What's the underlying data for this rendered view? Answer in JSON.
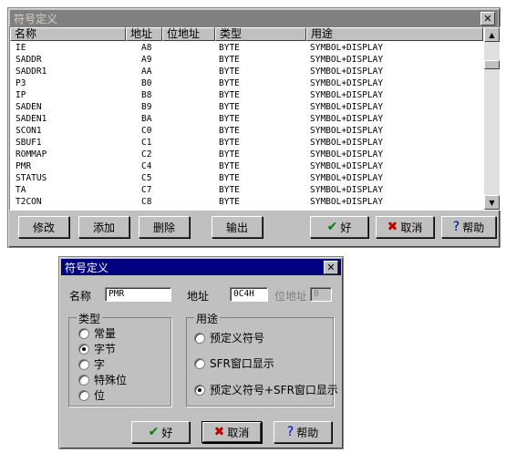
{
  "list_window": {
    "title": "符号定义",
    "close_glyph": "✕",
    "columns": [
      "名称",
      "地址",
      "位地址",
      "类型",
      "用途"
    ],
    "rows": [
      [
        "IE",
        "A8",
        "",
        "BYTE",
        "SYMBOL+DISPLAY"
      ],
      [
        "SADDR",
        "A9",
        "",
        "BYTE",
        "SYMBOL+DISPLAY"
      ],
      [
        "SADDR1",
        "AA",
        "",
        "BYTE",
        "SYMBOL+DISPLAY"
      ],
      [
        "P3",
        "B0",
        "",
        "BYTE",
        "SYMBOL+DISPLAY"
      ],
      [
        "IP",
        "B8",
        "",
        "BYTE",
        "SYMBOL+DISPLAY"
      ],
      [
        "SADEN",
        "B9",
        "",
        "BYTE",
        "SYMBOL+DISPLAY"
      ],
      [
        "SADEN1",
        "BA",
        "",
        "BYTE",
        "SYMBOL+DISPLAY"
      ],
      [
        "SCON1",
        "C0",
        "",
        "BYTE",
        "SYMBOL+DISPLAY"
      ],
      [
        "SBUF1",
        "C1",
        "",
        "BYTE",
        "SYMBOL+DISPLAY"
      ],
      [
        "ROMMAP",
        "C2",
        "",
        "BYTE",
        "SYMBOL+DISPLAY"
      ],
      [
        "PMR",
        "C4",
        "",
        "BYTE",
        "SYMBOL+DISPLAY"
      ],
      [
        "STATUS",
        "C5",
        "",
        "BYTE",
        "SYMBOL+DISPLAY"
      ],
      [
        "TA",
        "C7",
        "",
        "BYTE",
        "SYMBOL+DISPLAY"
      ],
      [
        "T2CON",
        "C8",
        "",
        "BYTE",
        "SYMBOL+DISPLAY"
      ]
    ],
    "buttons": {
      "edit": "修改",
      "add": "添加",
      "delete": "删除",
      "output": "输出",
      "ok": "好",
      "cancel": "取消",
      "help": "帮助"
    }
  },
  "edit_dialog": {
    "title": "符号定义",
    "close_glyph": "✕",
    "name_label": "名称",
    "name_value": "PMR",
    "address_label": "地址",
    "address_value": "0C4H",
    "bit_address_label": "位地址",
    "bit_address_value": "0",
    "type_group": {
      "title": "类型",
      "options": [
        "常量",
        "字节",
        "字",
        "特殊位",
        "位"
      ],
      "selected_index": 1
    },
    "usage_group": {
      "title": "用途",
      "options": [
        "预定义符号",
        "SFR窗口显示",
        "预定义符号+SFR窗口显示"
      ],
      "selected_index": 2
    },
    "buttons": {
      "ok": "好",
      "cancel": "取消",
      "help": "帮助"
    }
  },
  "colors": {
    "dialog_face": "#c0c0c0",
    "active_title": "#000080",
    "inactive_title": "#808080",
    "check_green": "#008000",
    "cross_red": "#c00000",
    "help_blue": "#0000c0"
  },
  "icons": {
    "ok": "check-icon",
    "cancel": "cross-icon",
    "help": "question-icon"
  }
}
